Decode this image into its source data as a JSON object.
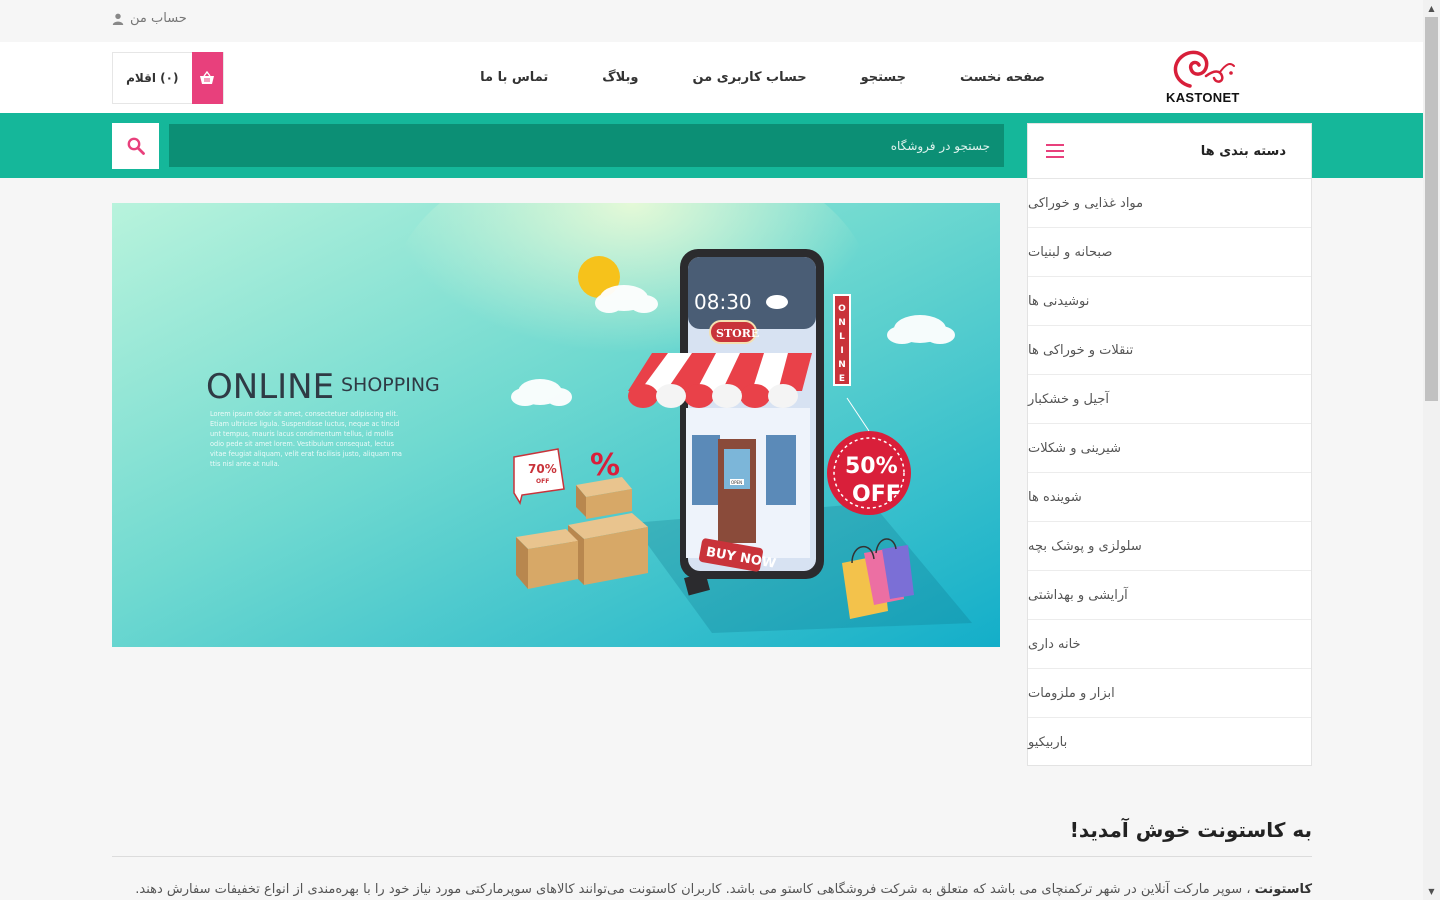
{
  "topbar": {
    "account_label": "حساب من"
  },
  "header": {
    "cart_label": "(۰) اقلام",
    "nav": [
      "صفحه نخست",
      "جستجو",
      "حساب کاربری من",
      "وبلاگ",
      "تماس با ما"
    ],
    "logo_text": "KASTONET"
  },
  "search": {
    "placeholder": "جستجو در فروشگاه"
  },
  "categories": {
    "title": "دسته بندی ها",
    "items": [
      "مواد غذایی و خوراکی",
      "صبحانه و لبنیات",
      "نوشیدنی ها",
      "تنقلات و خوراکی ها",
      "آجیل و خشکبار",
      "شیرینی و شکلات",
      "شوینده ها",
      "سلولزی و پوشک بچه",
      "آرایشی و بهداشتی",
      "خانه داری",
      "ابزار و ملزومات",
      "باربیکیو"
    ]
  },
  "banner": {
    "headline": "ONLINE",
    "subheadline": "SHOPPING",
    "lorem": [
      "Lorem ipsum dolor sit amet, consectetuer adipiscing elit.",
      "Etiam ultricies ligula. Suspendisse luctus, neque ac tincid",
      "unt tempus, mauris lacus condimentum tellus, id mollis",
      "odio pede sit amet lorem. Vestibulum consequat, lectus",
      "vitae feugiat aliquam, velit erat facilisis justo, aliquam ma",
      "ttis nisl ante at nulla."
    ],
    "time": "08:30",
    "store_sign": "STORE",
    "online_sign": "ONLINE",
    "discount_percent": "50%",
    "discount_off": "OFF",
    "tag_percent": "70%",
    "tag_off": "OFF",
    "percent_symbol": "%",
    "buy_now": "BUY NOW",
    "open_sign": "OPEN"
  },
  "welcome": {
    "title": "به کاستونت خوش آمدید!",
    "brand": "کاستونت",
    "text": "، سوپر مارکت آنلاین در شهر ترکمنچای می باشد که متعلق به شرکت فروشگاهی کاستو می باشد. کاربران کاستونت می‌توانند کالاهای سوپرمارکتی مورد نیاز خود را با بهره‌مندی از انواع تخفیفات سفارش دهند."
  },
  "colors": {
    "teal": "#15b79a",
    "teal_dark": "#0c8f75",
    "pink": "#e8407c"
  },
  "icons": {
    "account": "user-icon",
    "cart": "basket-icon",
    "search": "search-icon",
    "menu": "hamburger-icon"
  }
}
